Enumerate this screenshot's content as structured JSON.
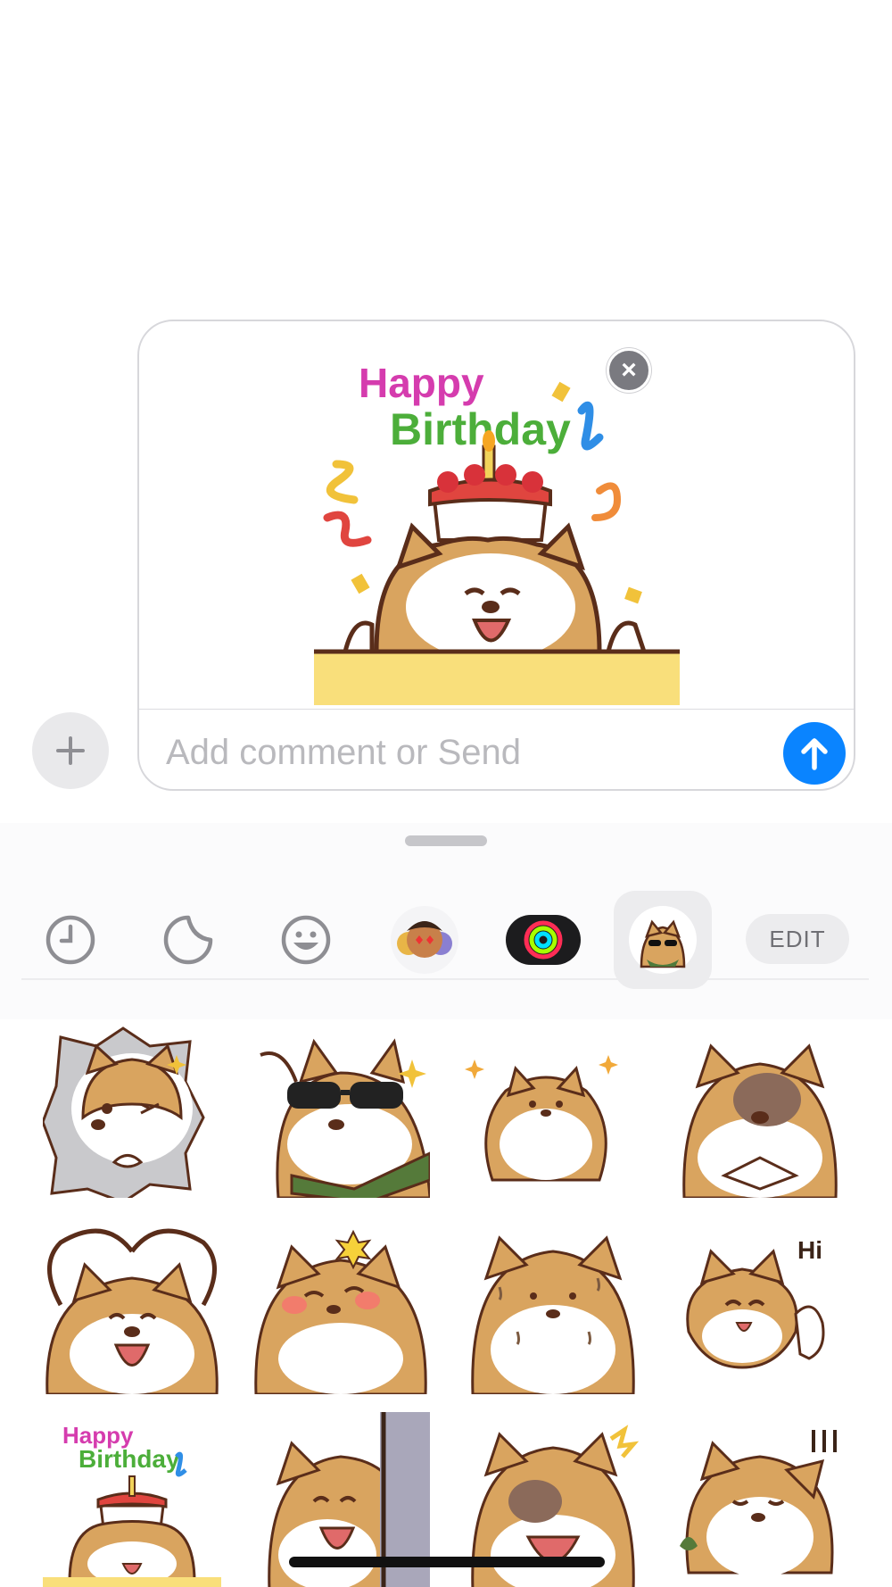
{
  "compose": {
    "placeholder": "Add comment or Send",
    "attached_sticker": {
      "text_line1": "Happy",
      "text_line2": "Birthday"
    }
  },
  "app_strip": {
    "items": [
      {
        "name": "recents",
        "icon": "clock-icon"
      },
      {
        "name": "stickers",
        "icon": "sticker-peel-icon"
      },
      {
        "name": "emoji",
        "icon": "smiley-icon"
      },
      {
        "name": "memoji",
        "icon": "memoji-icon"
      },
      {
        "name": "activity",
        "icon": "activity-rings-icon"
      },
      {
        "name": "shiba-stickers",
        "icon": "shiba-app-icon",
        "selected": true
      }
    ],
    "edit_label": "EDIT"
  },
  "stickers": [
    {
      "name": "shiba-burst-through"
    },
    {
      "name": "shiba-sunglasses"
    },
    {
      "name": "shiba-chubby-sitting"
    },
    {
      "name": "shiba-bruised"
    },
    {
      "name": "shiba-heart-arms"
    },
    {
      "name": "shiba-blush-flower"
    },
    {
      "name": "shiba-sweating"
    },
    {
      "name": "shiba-hi-wave",
      "text": "Hi"
    },
    {
      "name": "shiba-happy-birthday",
      "text_line1": "Happy",
      "text_line2": "Birthday"
    },
    {
      "name": "shiba-peek-wall"
    },
    {
      "name": "shiba-shocked"
    },
    {
      "name": "shiba-crying"
    }
  ],
  "colors": {
    "accent": "#0a84ff",
    "shiba": "#d9a45f",
    "outline": "#5a2d1a",
    "cake_base": "#f9df7b"
  }
}
